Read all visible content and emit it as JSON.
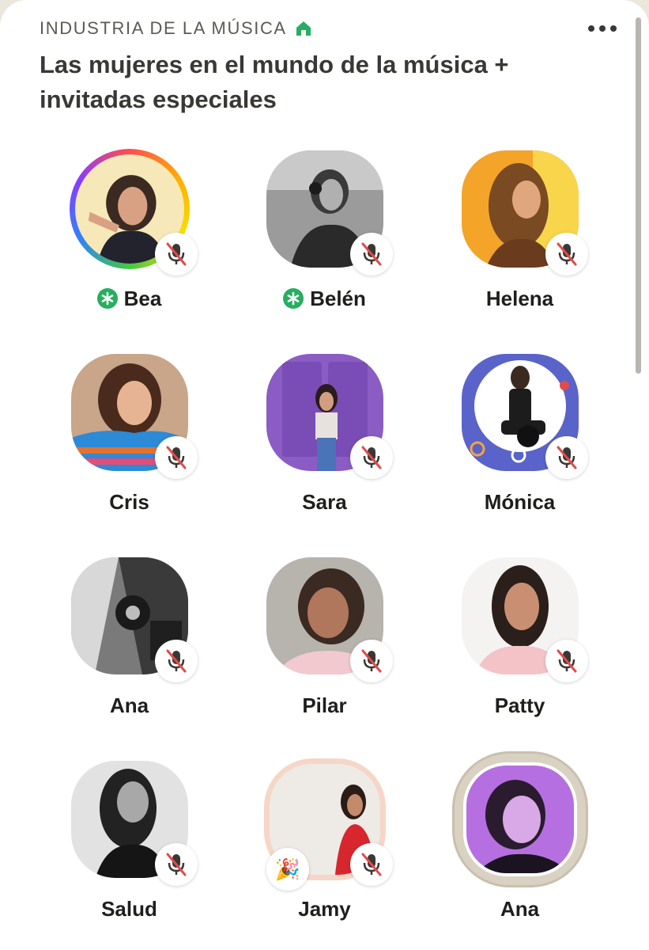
{
  "room": {
    "club_name": "INDUSTRIA DE LA MÚSICA",
    "club_icon": "home-icon",
    "title": "Las mujeres en el mundo de la música + invitadas especiales"
  },
  "speakers": [
    {
      "name": "Bea",
      "moderator": true,
      "muted": true,
      "ring": "rainbow",
      "photo": "woman-pointing"
    },
    {
      "name": "Belén",
      "moderator": true,
      "muted": true,
      "ring": "none",
      "photo": "woman-headphones-bw"
    },
    {
      "name": "Helena",
      "moderator": false,
      "muted": true,
      "ring": "none",
      "photo": "woman-curly-hair"
    },
    {
      "name": "Cris",
      "moderator": false,
      "muted": true,
      "ring": "none",
      "photo": "woman-striped-sweater"
    },
    {
      "name": "Sara",
      "moderator": false,
      "muted": true,
      "ring": "none",
      "photo": "woman-purple-door"
    },
    {
      "name": "Mónica",
      "moderator": false,
      "muted": true,
      "ring": "none",
      "photo": "woman-vinyl-record"
    },
    {
      "name": "Ana",
      "moderator": false,
      "muted": true,
      "ring": "none",
      "photo": "abstract-bw"
    },
    {
      "name": "Pilar",
      "moderator": false,
      "muted": true,
      "ring": "none",
      "photo": "woman-smiling"
    },
    {
      "name": "Patty",
      "moderator": false,
      "muted": true,
      "ring": "none",
      "photo": "woman-dark-hair"
    },
    {
      "name": "Salud",
      "moderator": false,
      "muted": true,
      "ring": "none",
      "photo": "woman-bw-portrait"
    },
    {
      "name": "Jamy",
      "moderator": false,
      "muted": true,
      "ring": "peach",
      "photo": "woman-red-top",
      "new_member_emoji": "🎉"
    },
    {
      "name": "Ana",
      "moderator": false,
      "muted": false,
      "ring": "speaking",
      "photo": "woman-purple-light"
    }
  ],
  "colors": {
    "accent_green": "#27ae60",
    "mute_red": "#e14b4b",
    "text_dark": "#1f1e1b",
    "text_muted": "#5d5a53"
  }
}
